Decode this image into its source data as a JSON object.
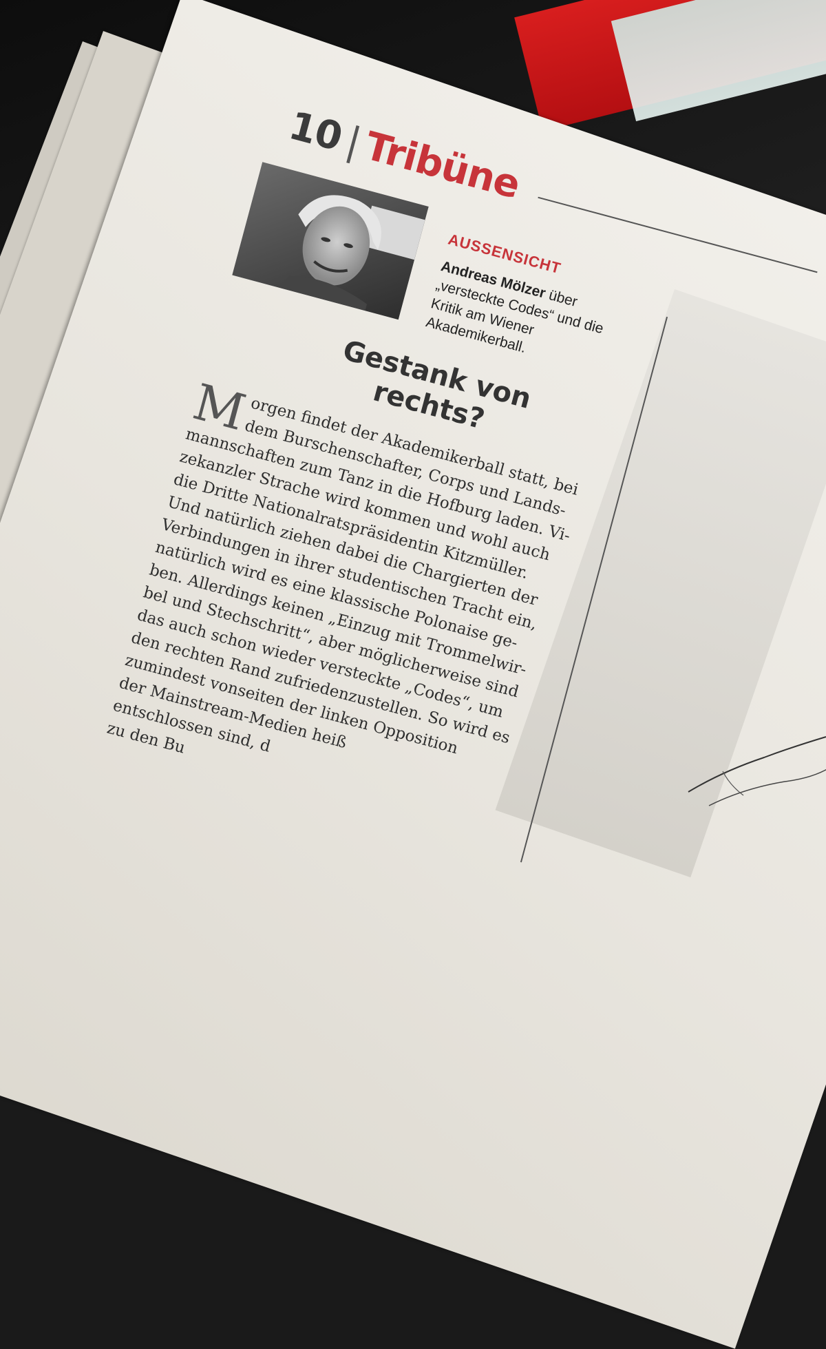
{
  "masthead": {
    "page_number": "10",
    "separator": "|",
    "section": "Tribüne"
  },
  "article": {
    "kicker": "AUSSENSICHT",
    "author": "Andreas Mölzer",
    "byline_rest": " über „versteckte Codes“ und die Kritik am Wiener Akademikerball.",
    "headline_line1": "Gestank von",
    "headline_line2": "rechts?",
    "dropcap": "M",
    "body_lines": [
      "orgen findet der Akademikerball statt, bei",
      "dem Burschenschafter, Corps und Lands-",
      "mannschaften zum Tanz in die Hofburg laden. Vi-",
      "zekanzler Strache wird kommen und wohl auch",
      "die Dritte Nationalratspräsidentin Kitzmüller.",
      "Und natürlich ziehen dabei die Chargierten der",
      "Verbindungen in ihrer studentischen Tracht ein,",
      "natürlich wird es eine klassische Polonaise ge-",
      "ben. Allerdings keinen „Einzug mit Trommelwir-",
      "bel und Stechschritt“, aber möglicherweise sind",
      "das auch schon wieder versteckte „Codes“, um",
      "den rechten Rand zufriedenzustellen. So wird es",
      "zumindest vonseiten der linken Opposition",
      "der Mainstream-Medien heiß",
      "entschlossen sind, d",
      "zu den Bu"
    ]
  },
  "colors": {
    "accent_red": "#c7343a",
    "paper": "#efece6",
    "ink": "#2e2e2e"
  }
}
